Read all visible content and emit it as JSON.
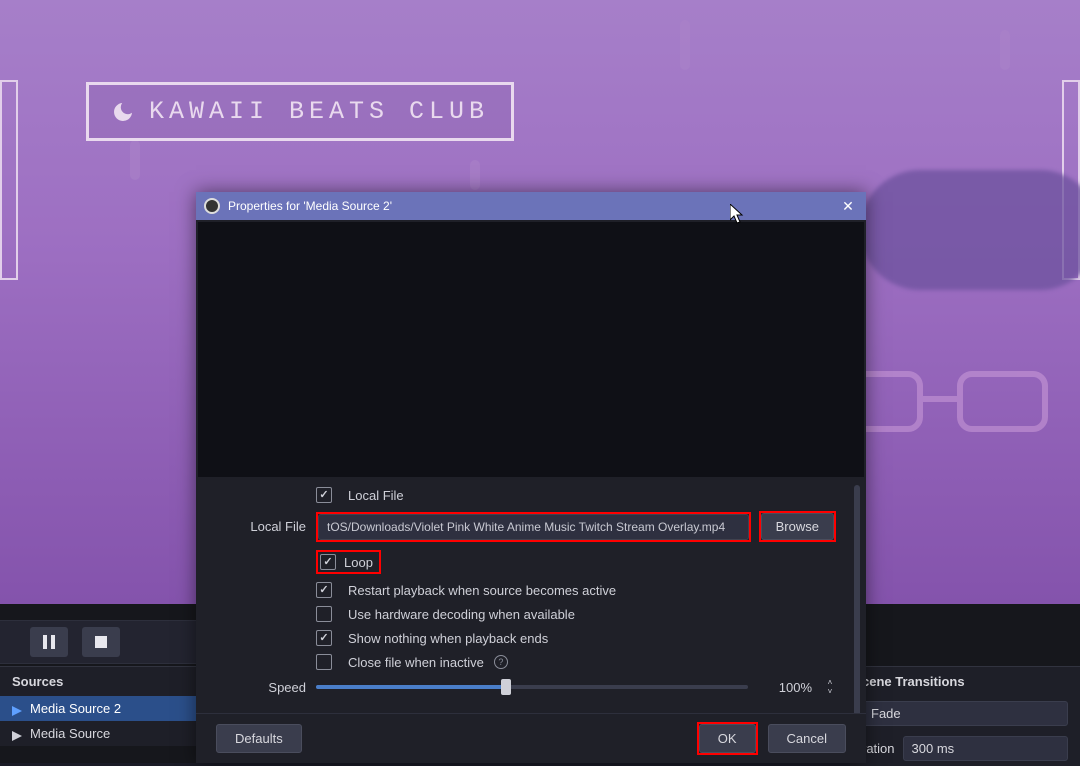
{
  "preview": {
    "overlay_title": "KAWAII BEATS CLUB"
  },
  "transport": {
    "pause_name": "pause-button",
    "stop_name": "stop-button"
  },
  "sources": {
    "header": "Sources",
    "items": [
      {
        "label": "Media Source 2",
        "selected": true
      },
      {
        "label": "Media Source",
        "selected": false
      }
    ]
  },
  "transitions": {
    "header_partial": "cene Transitions",
    "fade_label_partial": "Fade",
    "duration_label_partial": "ration",
    "duration_value": "300 ms"
  },
  "dialog": {
    "title": "Properties for 'Media Source 2'",
    "fields": {
      "local_file_checkbox": "Local File",
      "local_file_label": "Local File",
      "local_file_value": "tOS/Downloads/Violet Pink White Anime Music Twitch Stream Overlay.mp4",
      "browse": "Browse",
      "loop": "Loop",
      "restart": "Restart playback when source becomes active",
      "hw_decode": "Use hardware decoding when available",
      "show_nothing": "Show nothing when playback ends",
      "close_inactive": "Close file when inactive",
      "speed_label": "Speed",
      "speed_value": "100%"
    },
    "buttons": {
      "defaults": "Defaults",
      "ok": "OK",
      "cancel": "Cancel"
    }
  }
}
